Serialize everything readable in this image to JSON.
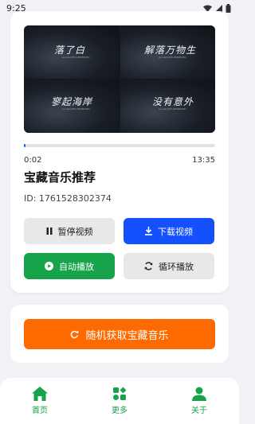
{
  "status_bar": {
    "time": "9:25"
  },
  "video": {
    "panels": [
      {
        "title": "落了白",
        "subtitle": "ALL RIGHTS RESERVED"
      },
      {
        "title": "解落万物生",
        "subtitle": "ALL RIGHTS RESERVED"
      },
      {
        "title": "寥起海岸",
        "subtitle": "ALL RIGHTS RESERVED"
      },
      {
        "title": "没有意外",
        "subtitle": "ALL RIGHTS RESERVED"
      }
    ]
  },
  "player": {
    "current_time": "0:02",
    "total_time": "13:35",
    "progress": 0.0025,
    "title": "宝藏音乐推荐",
    "id_text": "ID: 1761528302374"
  },
  "buttons": {
    "pause": "暂停视频",
    "download": "下载视频",
    "autoplay": "自动播放",
    "loop": "循环播放",
    "random": "随机获取宝藏音乐"
  },
  "nav": {
    "home": "首页",
    "more": "更多",
    "about": "关于"
  },
  "colors": {
    "accent_blue": "#1550ff",
    "accent_green": "#16a34a",
    "accent_orange": "#ff6a00"
  }
}
